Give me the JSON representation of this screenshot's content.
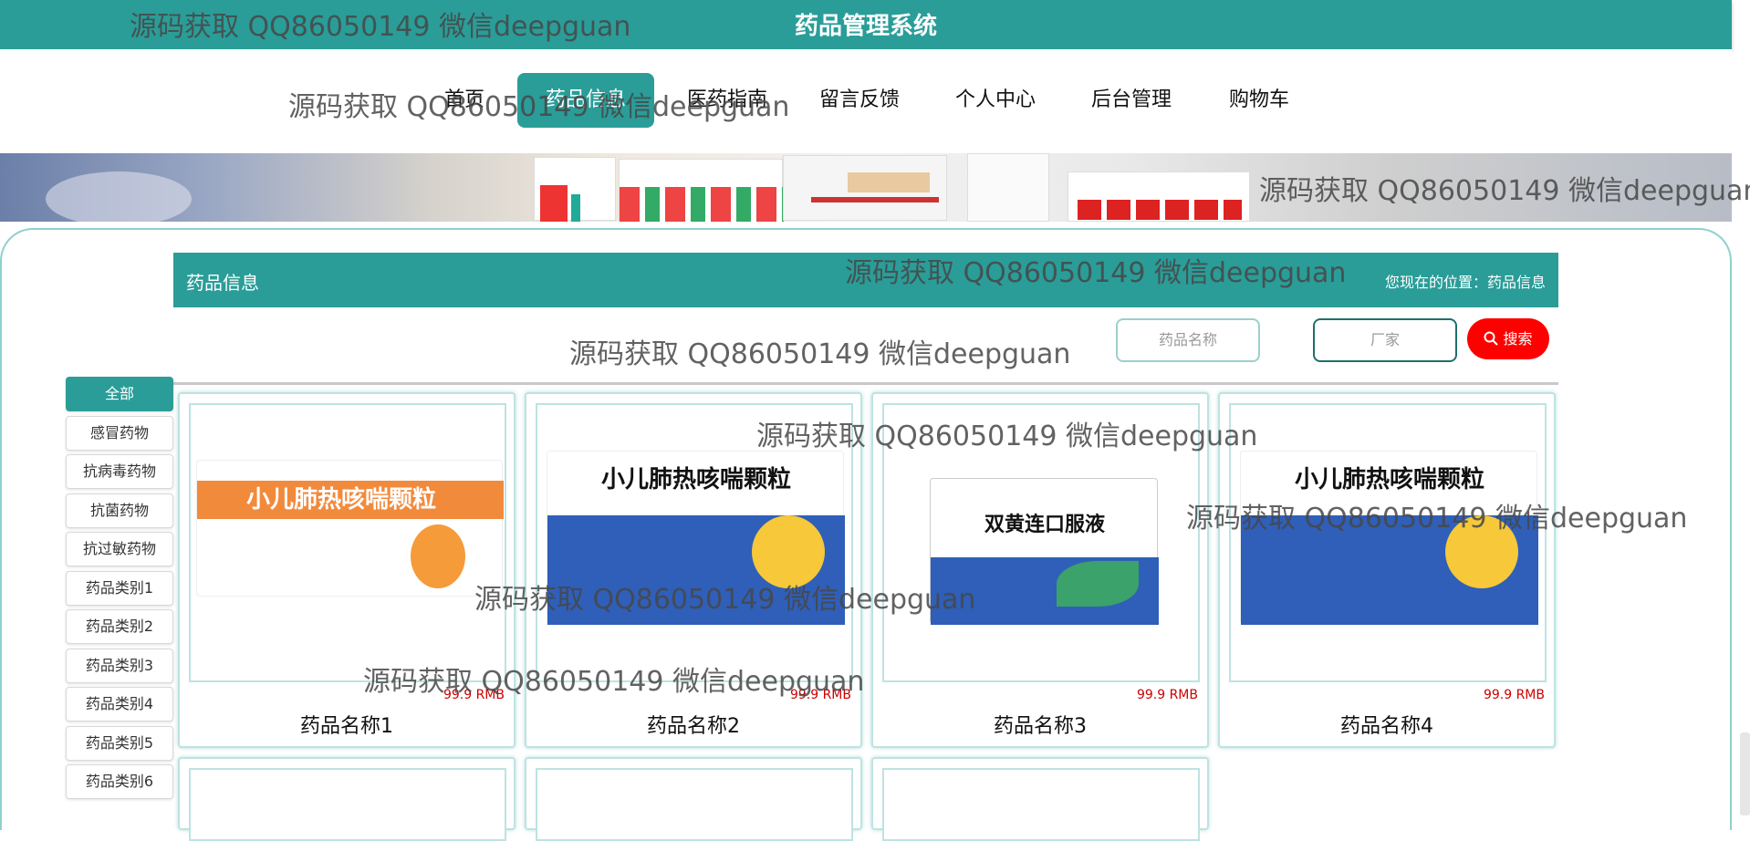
{
  "header": {
    "title": "药品管理系统"
  },
  "nav": {
    "items": [
      "首页",
      "药品信息",
      "医药指南",
      "留言反馈",
      "个人中心",
      "后台管理",
      "购物车"
    ],
    "active_index": 1
  },
  "section": {
    "title": "药品信息",
    "breadcrumb": "您现在的位置：药品信息"
  },
  "search": {
    "name_placeholder": "药品名称",
    "maker_placeholder": "厂家",
    "button_label": "搜索"
  },
  "categories": [
    "全部",
    "感冒药物",
    "抗病毒药物",
    "抗菌药物",
    "抗过敏药物",
    "药品类别1",
    "药品类别2",
    "药品类别3",
    "药品类别4",
    "药品类别5",
    "药品类别6"
  ],
  "products": [
    {
      "name": "药品名称1",
      "price": "99.9 RMB",
      "box_text": "小儿肺热咳喘颗粒",
      "box_color": "#f28a3c"
    },
    {
      "name": "药品名称2",
      "price": "99.9 RMB",
      "box_text": "小儿肺热咳喘颗粒",
      "box_color": "#2f5fb8"
    },
    {
      "name": "药品名称3",
      "price": "99.9 RMB",
      "box_text": "双黄连口服液",
      "box_color": "#2f5fb8"
    },
    {
      "name": "药品名称4",
      "price": "99.9 RMB",
      "box_text": "小儿肺热咳喘颗粒",
      "box_color": "#2f5fb8"
    }
  ],
  "watermark_text": "源码获取 QQ86050149 微信deepguan",
  "colors": {
    "primary": "#2a9d98",
    "accent": "#ff0000",
    "price": "#cc0000"
  }
}
